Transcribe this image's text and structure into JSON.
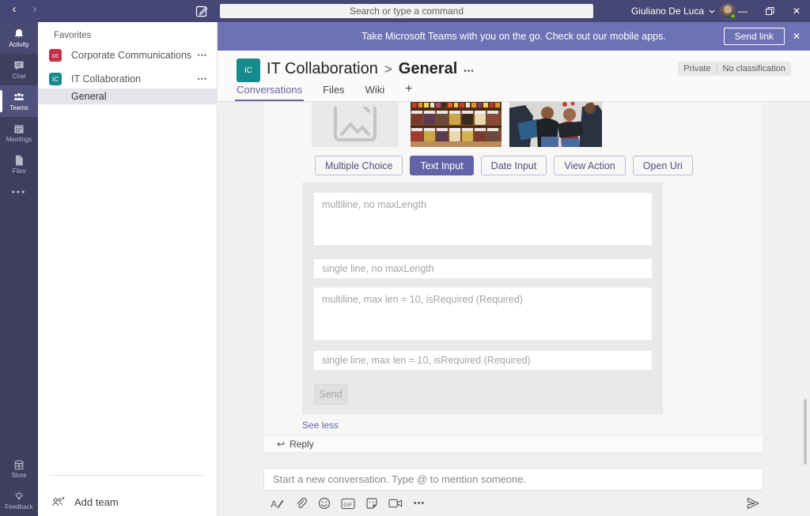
{
  "titlebar": {
    "search_placeholder": "Search or type a command",
    "user_name": "Giuliano De Luca"
  },
  "banner": {
    "message": "Take Microsoft Teams with you on the go. Check out our mobile apps.",
    "send_link_label": "Send link"
  },
  "rail": {
    "items": [
      {
        "label": "Activity"
      },
      {
        "label": "Chat"
      },
      {
        "label": "Teams"
      },
      {
        "label": "Meetings"
      },
      {
        "label": "Files"
      }
    ],
    "bottom_items": [
      {
        "label": "Store"
      },
      {
        "label": "Feedback"
      }
    ]
  },
  "sidebar": {
    "section_label": "Favorites",
    "teams": [
      {
        "initials": "cc",
        "name": "Corporate Communications"
      },
      {
        "initials": "IC",
        "name": "IT Collaboration"
      }
    ],
    "selected_channel": "General",
    "row_more": "•••",
    "add_team_label": "Add team"
  },
  "header": {
    "team_initials": "IC",
    "team_name": "IT Collaboration",
    "separator": ">",
    "more": "•••",
    "channel_name": "General",
    "privacy_badge": "Private",
    "classification_badge": "No classification",
    "tabs": [
      {
        "label": "Conversations",
        "active": true
      },
      {
        "label": "Files",
        "active": false
      },
      {
        "label": "Wiki",
        "active": false
      }
    ],
    "add_tab": "+"
  },
  "message_card": {
    "action_buttons": [
      {
        "label": "Multiple Choice",
        "style": "outline"
      },
      {
        "label": "Text Input",
        "style": "primary"
      },
      {
        "label": "Date Input",
        "style": "outline"
      },
      {
        "label": "View Action",
        "style": "outline"
      },
      {
        "label": "Open Uri",
        "style": "outline"
      }
    ],
    "form_fields": [
      {
        "placeholder": "multiline, no maxLength",
        "multiline": true
      },
      {
        "placeholder": "single line, no maxLength",
        "multiline": false
      },
      {
        "placeholder": "multiline, max len = 10, isRequired (Required)",
        "multiline": true
      },
      {
        "placeholder": "single line, max len = 10, isRequired (Required)",
        "multiline": false
      }
    ],
    "send_button_label": "Send",
    "see_less_label": "See less",
    "reply_label": "Reply"
  },
  "compose": {
    "placeholder": "Start a new conversation. Type @ to mention someone."
  },
  "glyphs": {
    "back": "‹",
    "forward": "›",
    "minimize": "—",
    "close": "✕",
    "reply_arrow": "↩",
    "more_dots": "•••",
    "gif": "GIF"
  },
  "colors": {
    "titlebar": "#464775",
    "banner": "#6e72b4",
    "rail": "#3e3f5e",
    "accent": "#6264a7",
    "team_badge_red": "#c4314b",
    "team_badge_teal": "#178a8e",
    "presence_green": "#6bb700"
  }
}
